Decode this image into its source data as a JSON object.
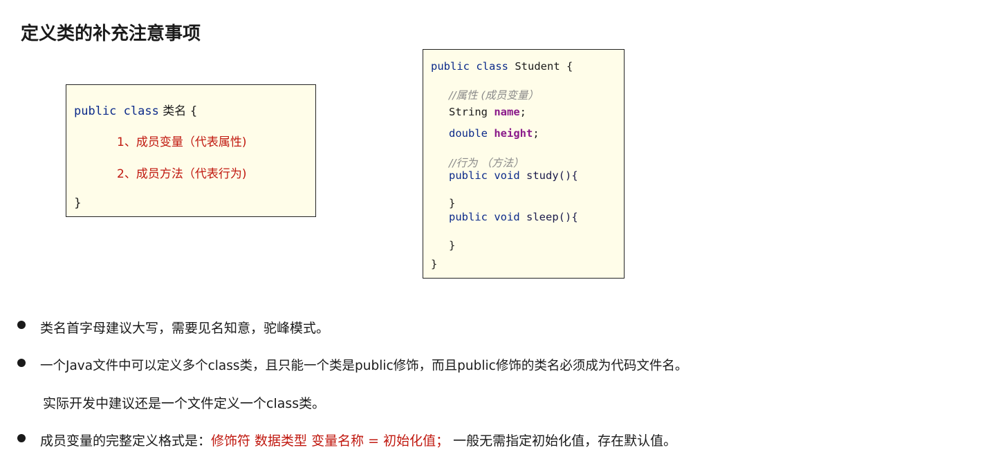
{
  "title": "定义类的补充注意事项",
  "template_box": {
    "line1_kw": "public class",
    "line1_name": "类名 {",
    "item1": "1、成员变量（代表属性)",
    "item2": "2、成员方法（代表行为)",
    "close": "}"
  },
  "example_box": {
    "l1_kw": "public class",
    "l1_name": "Student {",
    "comment1": "//属性 (成员变量）",
    "l3_type": "String",
    "l3_field": "name",
    "l3_end": ";",
    "l4_type": "double",
    "l4_field": "height",
    "l4_end": ";",
    "comment2": "//行为 （方法）",
    "l6_kw": "public void",
    "l6_fn": "study(){",
    "l7": "}",
    "l8_kw": "public void",
    "l8_fn": "sleep(){",
    "l9": "}",
    "l10": "}"
  },
  "bullets": {
    "b1": "类名首字母建议大写，需要见名知意，驼峰模式。",
    "b2": "一个Java文件中可以定义多个class类，且只能一个类是public修饰，而且public修饰的类名必须成为代码文件名。",
    "b2_note": "实际开发中建议还是一个文件定义一个class类。",
    "b3_prefix": "成员变量的完整定义格式是：",
    "b3_red": "修饰符 数据类型 变量名称 = 初始化值；",
    "b3_suffix": " 一般无需指定初始化值，存在默认值。"
  }
}
